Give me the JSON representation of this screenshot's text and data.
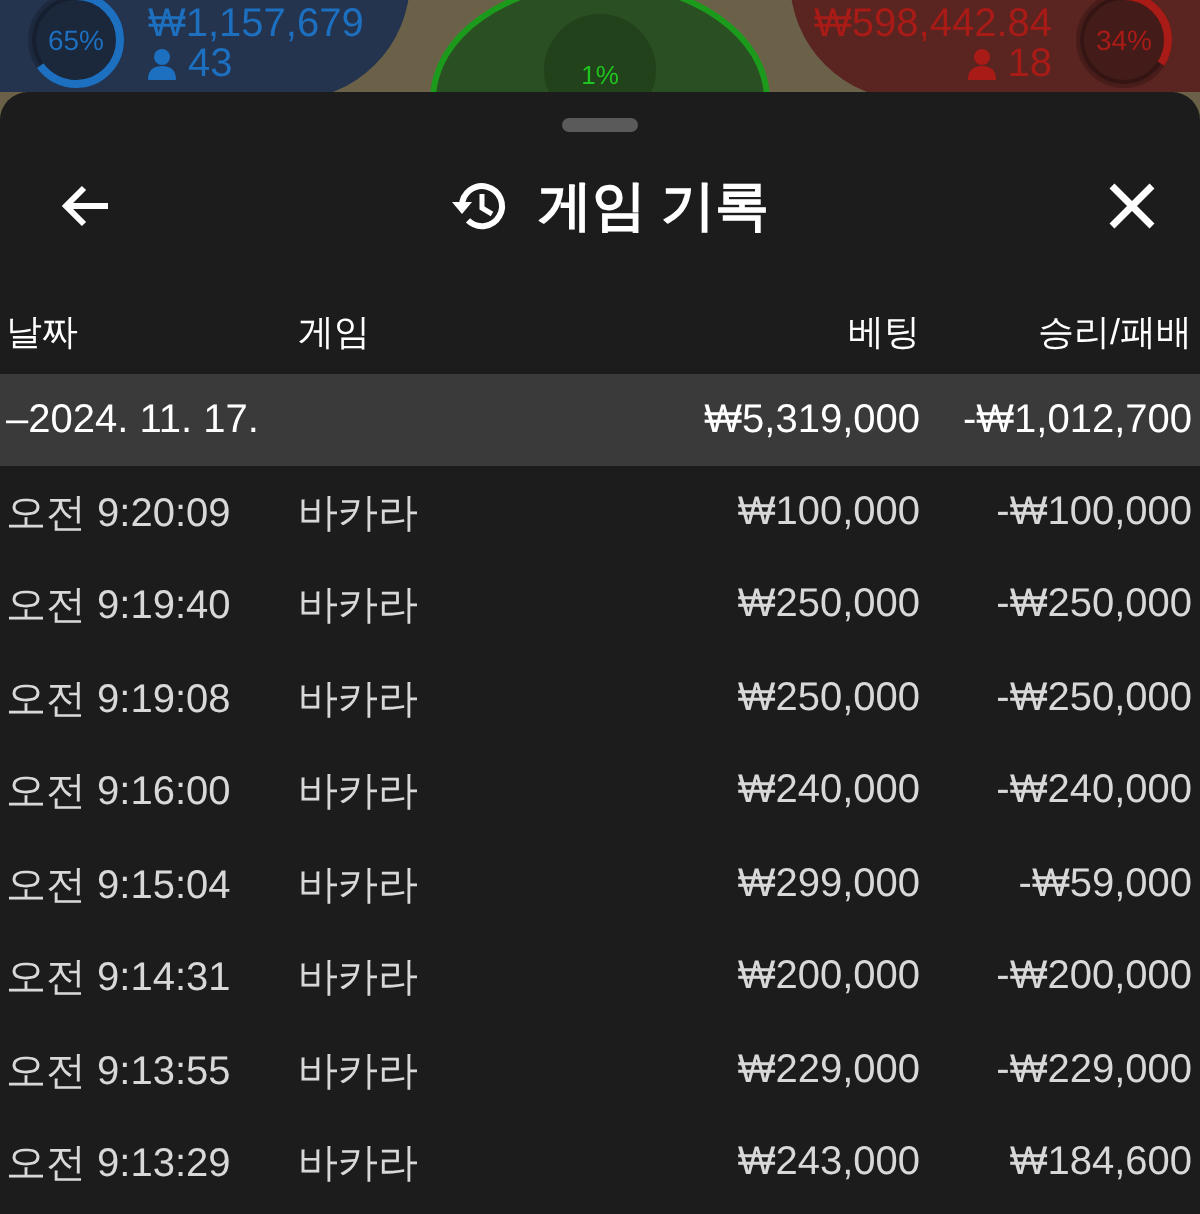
{
  "game_status": {
    "player": {
      "percent": "65%",
      "amount": "₩1,157,679",
      "count": "43"
    },
    "tie": {
      "percent": "1%"
    },
    "banker": {
      "percent": "34%",
      "amount": "₩598,442.84",
      "count": "18"
    }
  },
  "sheet": {
    "title": "게임 기록",
    "columns": [
      "날짜",
      "게임",
      "베팅",
      "승리/패배"
    ],
    "group": {
      "date": "–2024. 11. 17.",
      "bet": "₩5,319,000",
      "result": "-₩1,012,700"
    },
    "rows": [
      {
        "time": "오전 9:20:09",
        "game": "바카라",
        "bet": "₩100,000",
        "result": "-₩100,000"
      },
      {
        "time": "오전 9:19:40",
        "game": "바카라",
        "bet": "₩250,000",
        "result": "-₩250,000"
      },
      {
        "time": "오전 9:19:08",
        "game": "바카라",
        "bet": "₩250,000",
        "result": "-₩250,000"
      },
      {
        "time": "오전 9:16:00",
        "game": "바카라",
        "bet": "₩240,000",
        "result": "-₩240,000"
      },
      {
        "time": "오전 9:15:04",
        "game": "바카라",
        "bet": "₩299,000",
        "result": "-₩59,000"
      },
      {
        "time": "오전 9:14:31",
        "game": "바카라",
        "bet": "₩200,000",
        "result": "-₩200,000"
      },
      {
        "time": "오전 9:13:55",
        "game": "바카라",
        "bet": "₩229,000",
        "result": "-₩229,000"
      },
      {
        "time": "오전 9:13:29",
        "game": "바카라",
        "bet": "₩243,000",
        "result": "₩184,600"
      }
    ]
  }
}
